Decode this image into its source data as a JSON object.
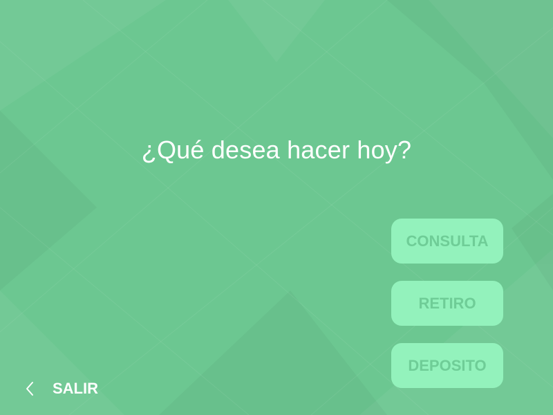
{
  "screen": {
    "background_color": "#6cc791",
    "question": "¿Qué desea hacer hoy?"
  },
  "options": {
    "consulta": "CONSULTA",
    "retiro": "RETIRO",
    "deposito": "DEPOSITO",
    "button_color": "#93f2bc",
    "button_text_color": "#6fcd97"
  },
  "footer": {
    "exit_label": "SALIR",
    "exit_icon": "chevron-left-icon"
  }
}
